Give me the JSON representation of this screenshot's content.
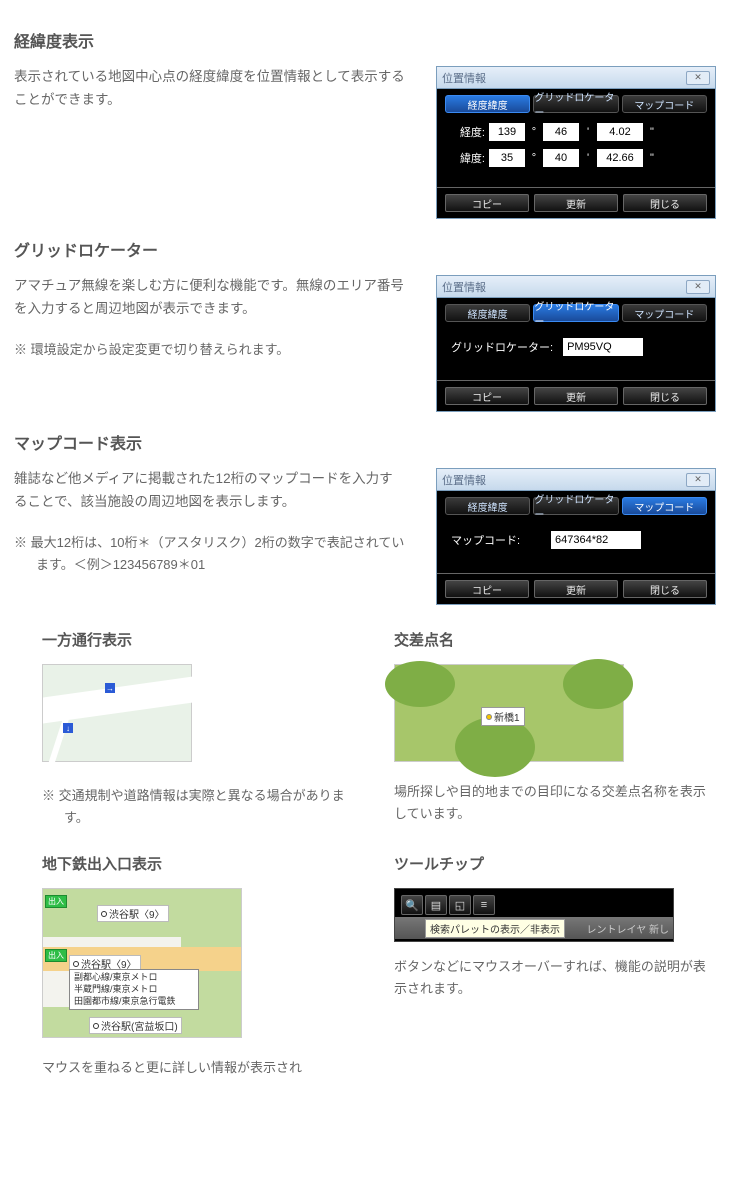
{
  "sections": {
    "coord": {
      "heading": "経緯度表示",
      "text": "表示されている地図中心点の経度緯度を位置情報として表示することができます。"
    },
    "grid": {
      "heading": "グリッドロケーター",
      "text": "アマチュア無線を楽しむ方に便利な機能です。無線のエリア番号を入力すると周辺地図が表示できます。",
      "note": "※ 環境設定から設定変更で切り替えられます。"
    },
    "mapcode": {
      "heading": "マップコード表示",
      "text": "雑誌など他メディアに掲載された12桁のマップコードを入力することで、該当施設の周辺地図を表示します。",
      "note": "※ 最大12桁は、10桁＊（アスタリスク）2桁の数字で表記されています。＜例＞123456789＊01"
    },
    "oneway": {
      "heading": "一方通行表示",
      "note": "※ 交通規制や道路情報は実際と異なる場合があります。"
    },
    "intersection": {
      "heading": "交差点名",
      "body": "場所探しや目的地までの目印になる交差点名称を表示しています。",
      "label": "新橋1"
    },
    "subway": {
      "heading": "地下鉄出入口表示",
      "body_trail": "マウスを重ねると更に詳しい情報が表示され",
      "station1": "渋谷駅〈9〉",
      "station2": "渋谷駅〈9〉",
      "station3": "渋谷駅(宮益坂口)",
      "entry_badge": "出入",
      "lines": [
        "副都心線/東京メトロ",
        "半蔵門線/東京メトロ",
        "田園都市線/東京急行電鉄"
      ]
    },
    "tooltip": {
      "heading": "ツールチップ",
      "body": "ボタンなどにマウスオーバーすれば、機能の説明が表示されます。",
      "tooltip_text": "検索パレットの表示／非表示",
      "layer_text_1": "レントレイヤ",
      "layer_text_2": "新し"
    }
  },
  "dialog": {
    "title": "位置情報",
    "tabs": {
      "coord": "経度緯度",
      "grid": "グリッドロケーター",
      "mapcode": "マップコード"
    },
    "coord": {
      "lon_label": "経度:",
      "lat_label": "緯度:",
      "lon": [
        "139",
        "46",
        "4.02"
      ],
      "lat": [
        "35",
        "40",
        "42.66"
      ],
      "deg": "°",
      "min": "'",
      "sec": "\""
    },
    "grid": {
      "label": "グリッドロケーター:",
      "value": "PM95VQ"
    },
    "mapcode": {
      "label": "マップコード:",
      "value": "647364*82"
    },
    "buttons": {
      "copy": "コピー",
      "update": "更新",
      "close": "閉じる"
    }
  }
}
